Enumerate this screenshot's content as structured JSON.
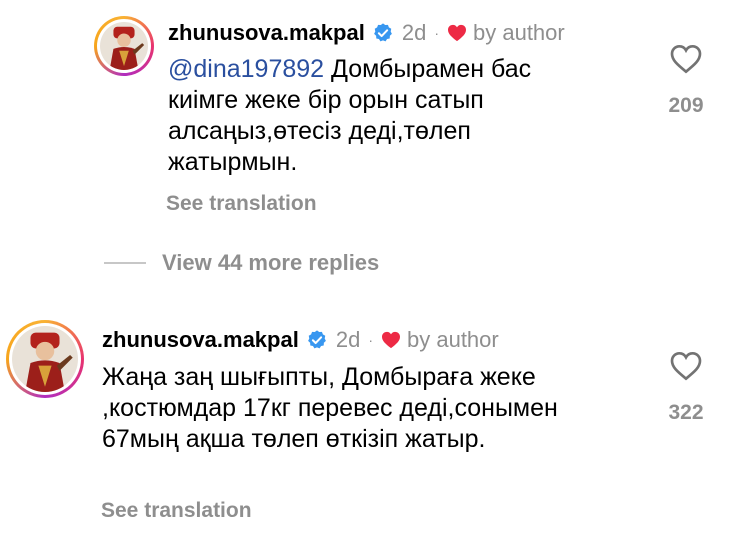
{
  "comments": [
    {
      "username": "zhunusova.makpal",
      "time": "2d",
      "separator": "·",
      "author_label": "by author",
      "mention": "@dina197892",
      "text": "Домбырамен бас киімге жеке бір орын сатып алсаңыз,өтесіз деді,төлеп жатырмын.",
      "see_translation": "See translation",
      "likes": "209"
    },
    {
      "username": "zhunusova.makpal",
      "time": "2d",
      "separator": "·",
      "author_label": "by author",
      "mention": "",
      "text": "Жаңа заң шығыпты, Домбыраға жеке ,костюмдар 17кг перевес деді,сонымен 67мың ақша төлеп өткізіп жатыр.",
      "see_translation": "See translation",
      "likes": "322"
    }
  ],
  "view_replies": "View 44 more replies",
  "colors": {
    "accent_link": "#2a4f9f",
    "secondary_text": "#8e8e8e",
    "heart_red": "#ed2a45",
    "verified_blue": "#3897f0"
  },
  "icons": {
    "like": "heart-outline-icon",
    "author_like": "heart-filled-icon",
    "verified": "verified-badge-icon"
  }
}
